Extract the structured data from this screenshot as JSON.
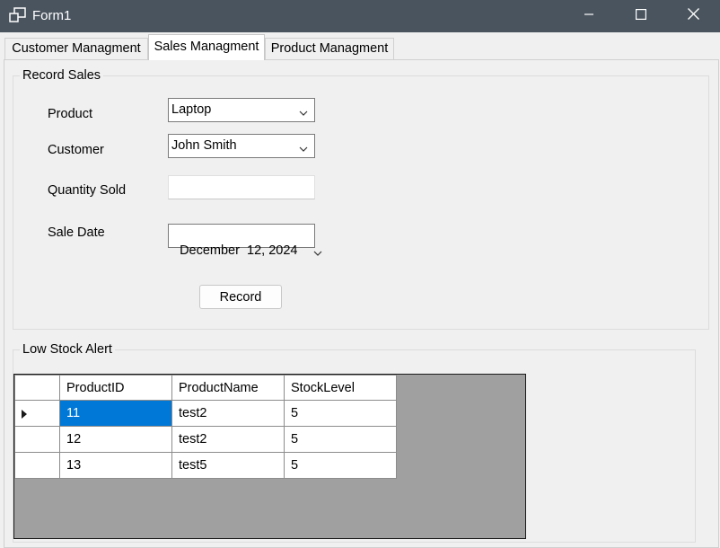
{
  "window": {
    "title": "Form1"
  },
  "tabs": [
    {
      "label": "Customer Managment"
    },
    {
      "label": "Sales Managment"
    },
    {
      "label": "Product Managment"
    }
  ],
  "record_sales": {
    "legend": "Record Sales",
    "product_label": "Product",
    "product_value": "Laptop",
    "customer_label": "Customer",
    "customer_value": "John Smith",
    "quantity_label": "Quantity Sold",
    "quantity_value": "",
    "date_label": "Sale Date",
    "date_value": "December  12, 2024",
    "record_button": "Record"
  },
  "low_stock": {
    "legend": "Low Stock Alert",
    "columns": [
      "ProductID",
      "ProductName",
      "StockLevel"
    ],
    "rows": [
      [
        "11",
        "test2",
        "5"
      ],
      [
        "12",
        "test2",
        "5"
      ],
      [
        "13",
        "test5",
        "5"
      ]
    ],
    "selected_row": 0
  },
  "colors": {
    "titlebar": "#4a545e",
    "selection": "#0078d7",
    "grid_background": "#a0a0a0"
  },
  "icons": {
    "app": "form-window-icon",
    "minimize": "minimize-icon",
    "maximize": "maximize-icon",
    "close": "close-icon",
    "dropdown": "chevron-down-icon",
    "row_indicator": "current-row-arrow-icon"
  }
}
